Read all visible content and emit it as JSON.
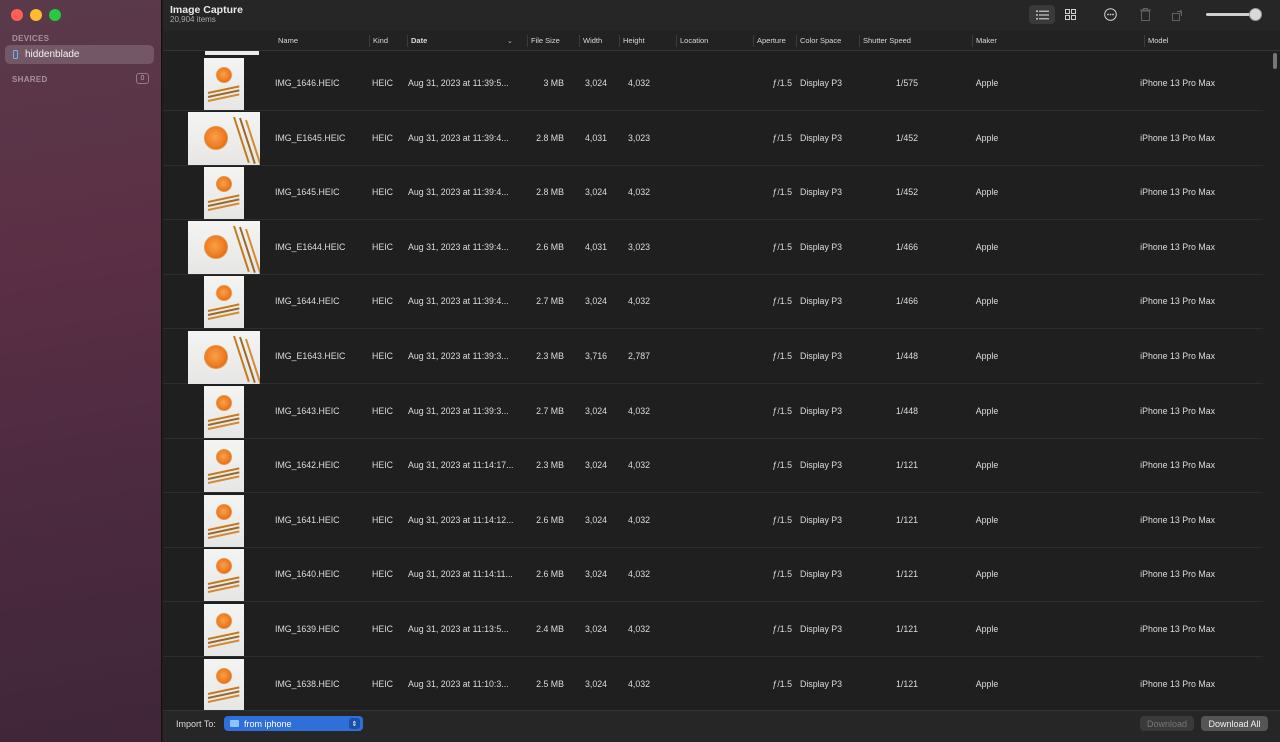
{
  "app": {
    "title": "Image Capture",
    "item_count": "20,904 items"
  },
  "sidebar": {
    "devices_label": "DEVICES",
    "device_name": "hiddenblade",
    "shared_label": "SHARED",
    "shared_count": "0"
  },
  "toolbar": {
    "list_view_icon": "list-icon",
    "grid_view_icon": "grid-icon",
    "more_icon": "ellipsis-circle-icon",
    "delete_icon": "trash-icon",
    "rotate_icon": "rotate-icon"
  },
  "columns": {
    "name": "Name",
    "kind": "Kind",
    "date": "Date",
    "file_size": "File Size",
    "width": "Width",
    "height": "Height",
    "location": "Location",
    "aperture": "Aperture",
    "color_space": "Color Space",
    "shutter_speed": "Shutter Speed",
    "maker": "Maker",
    "model": "Model"
  },
  "rows": [
    {
      "name": "IMG_1646.HEIC",
      "kind": "HEIC",
      "date": "Aug 31, 2023 at 11:39:5...",
      "size": "3 MB",
      "width": "3,024",
      "height": "4,032",
      "aperture": "ƒ/1.5",
      "color_space": "Display P3",
      "shutter": "1/575",
      "maker": "Apple",
      "model": "iPhone 13 Pro Max",
      "orientation": "portrait"
    },
    {
      "name": "IMG_E1645.HEIC",
      "kind": "HEIC",
      "date": "Aug 31, 2023 at 11:39:4...",
      "size": "2.8 MB",
      "width": "4,031",
      "height": "3,023",
      "aperture": "ƒ/1.5",
      "color_space": "Display P3",
      "shutter": "1/452",
      "maker": "Apple",
      "model": "iPhone 13 Pro Max",
      "orientation": "landscape"
    },
    {
      "name": "IMG_1645.HEIC",
      "kind": "HEIC",
      "date": "Aug 31, 2023 at 11:39:4...",
      "size": "2.8 MB",
      "width": "3,024",
      "height": "4,032",
      "aperture": "ƒ/1.5",
      "color_space": "Display P3",
      "shutter": "1/452",
      "maker": "Apple",
      "model": "iPhone 13 Pro Max",
      "orientation": "portrait"
    },
    {
      "name": "IMG_E1644.HEIC",
      "kind": "HEIC",
      "date": "Aug 31, 2023 at 11:39:4...",
      "size": "2.6 MB",
      "width": "4,031",
      "height": "3,023",
      "aperture": "ƒ/1.5",
      "color_space": "Display P3",
      "shutter": "1/466",
      "maker": "Apple",
      "model": "iPhone 13 Pro Max",
      "orientation": "landscape"
    },
    {
      "name": "IMG_1644.HEIC",
      "kind": "HEIC",
      "date": "Aug 31, 2023 at 11:39:4...",
      "size": "2.7 MB",
      "width": "3,024",
      "height": "4,032",
      "aperture": "ƒ/1.5",
      "color_space": "Display P3",
      "shutter": "1/466",
      "maker": "Apple",
      "model": "iPhone 13 Pro Max",
      "orientation": "portrait"
    },
    {
      "name": "IMG_E1643.HEIC",
      "kind": "HEIC",
      "date": "Aug 31, 2023 at 11:39:3...",
      "size": "2.3 MB",
      "width": "3,716",
      "height": "2,787",
      "aperture": "ƒ/1.5",
      "color_space": "Display P3",
      "shutter": "1/448",
      "maker": "Apple",
      "model": "iPhone 13 Pro Max",
      "orientation": "landscape"
    },
    {
      "name": "IMG_1643.HEIC",
      "kind": "HEIC",
      "date": "Aug 31, 2023 at 11:39:3...",
      "size": "2.7 MB",
      "width": "3,024",
      "height": "4,032",
      "aperture": "ƒ/1.5",
      "color_space": "Display P3",
      "shutter": "1/448",
      "maker": "Apple",
      "model": "iPhone 13 Pro Max",
      "orientation": "portrait"
    },
    {
      "name": "IMG_1642.HEIC",
      "kind": "HEIC",
      "date": "Aug 31, 2023 at 11:14:17...",
      "size": "2.3 MB",
      "width": "3,024",
      "height": "4,032",
      "aperture": "ƒ/1.5",
      "color_space": "Display P3",
      "shutter": "1/121",
      "maker": "Apple",
      "model": "iPhone 13 Pro Max",
      "orientation": "portrait"
    },
    {
      "name": "IMG_1641.HEIC",
      "kind": "HEIC",
      "date": "Aug 31, 2023 at 11:14:12...",
      "size": "2.6 MB",
      "width": "3,024",
      "height": "4,032",
      "aperture": "ƒ/1.5",
      "color_space": "Display P3",
      "shutter": "1/121",
      "maker": "Apple",
      "model": "iPhone 13 Pro Max",
      "orientation": "portrait"
    },
    {
      "name": "IMG_1640.HEIC",
      "kind": "HEIC",
      "date": "Aug 31, 2023 at 11:14:11...",
      "size": "2.6 MB",
      "width": "3,024",
      "height": "4,032",
      "aperture": "ƒ/1.5",
      "color_space": "Display P3",
      "shutter": "1/121",
      "maker": "Apple",
      "model": "iPhone 13 Pro Max",
      "orientation": "portrait"
    },
    {
      "name": "IMG_1639.HEIC",
      "kind": "HEIC",
      "date": "Aug 31, 2023 at 11:13:5...",
      "size": "2.4 MB",
      "width": "3,024",
      "height": "4,032",
      "aperture": "ƒ/1.5",
      "color_space": "Display P3",
      "shutter": "1/121",
      "maker": "Apple",
      "model": "iPhone 13 Pro Max",
      "orientation": "portrait"
    },
    {
      "name": "IMG_1638.HEIC",
      "kind": "HEIC",
      "date": "Aug 31, 2023 at 11:10:3...",
      "size": "2.5 MB",
      "width": "3,024",
      "height": "4,032",
      "aperture": "ƒ/1.5",
      "color_space": "Display P3",
      "shutter": "1/121",
      "maker": "Apple",
      "model": "iPhone 13 Pro Max",
      "orientation": "portrait"
    }
  ],
  "bottom": {
    "import_to_label": "Import To:",
    "import_to_value": "from iphone",
    "download_label": "Download",
    "download_all_label": "Download All"
  }
}
